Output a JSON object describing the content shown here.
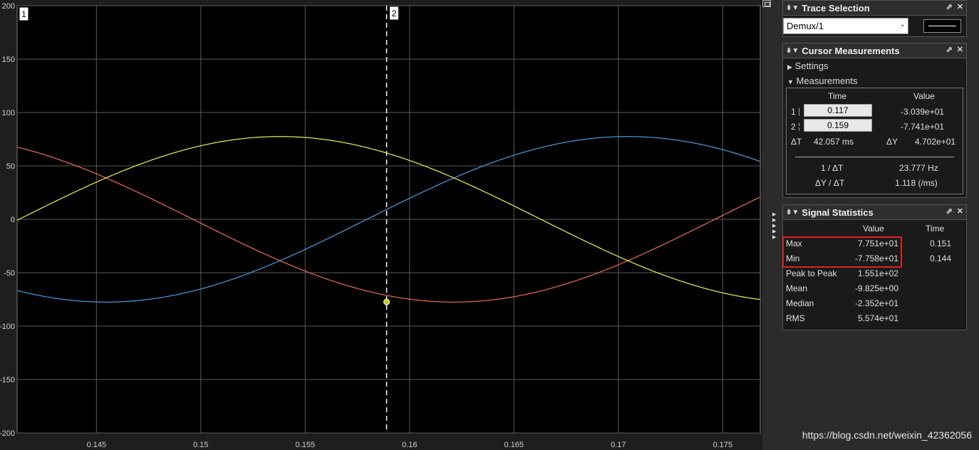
{
  "plot": {
    "y_ticks": [
      "200",
      "150",
      "100",
      "50",
      "0",
      "-50",
      "-100",
      "-150",
      "-200"
    ],
    "x_ticks": [
      "0.145",
      "0.15",
      "0.155",
      "0.16",
      "0.165",
      "0.17",
      "0.175"
    ],
    "cursor1_label": "1",
    "cursor2_label": "2",
    "colors": {
      "background": "#000000",
      "grid": "#5a5a5a",
      "cursor": "#ffffff"
    }
  },
  "chart_data": {
    "type": "line",
    "x_range": [
      0.1412,
      0.1768
    ],
    "ylim": [
      -200,
      200
    ],
    "grid": true,
    "frequency_hz": 20,
    "amplitude": 77.5,
    "series": [
      {
        "color": "#4a9ce0",
        "phase_rad": -1.0
      },
      {
        "color": "#e8704f",
        "phase_rad": -3.0944
      },
      {
        "color": "#f0f058",
        "phase_rad": 1.0944
      }
    ],
    "cursor_marker": {
      "x": 0.1589,
      "y": -77.4
    }
  },
  "trace_selection": {
    "title": "Trace Selection",
    "selected": "Demux/1"
  },
  "cursor_measurements": {
    "title": "Cursor Measurements",
    "settings_label": "Settings",
    "measurements_label": "Measurements",
    "col_time": "Time",
    "col_value": "Value",
    "row1_idx": "1",
    "row1_time": "0.117",
    "row1_value": "-3.039e+01",
    "row2_idx": "2",
    "row2_time": "0.159",
    "row2_value": "-7.741e+01",
    "dt_label": "ΔT",
    "dt_value": "42.057 ms",
    "dy_label": "ΔY",
    "dy_value": "4.702e+01",
    "inv_dt_label": "1 / ΔT",
    "inv_dt_value": "23.777 Hz",
    "dydt_label": "ΔY / ΔT",
    "dydt_value": "1.118 (/ms)"
  },
  "signal_statistics": {
    "title": "Signal Statistics",
    "col_value": "Value",
    "col_time": "Time",
    "rows": [
      {
        "label": "Max",
        "value": "7.751e+01",
        "time": "0.151"
      },
      {
        "label": "Min",
        "value": "-7.758e+01",
        "time": "0.144"
      },
      {
        "label": "Peak to Peak",
        "value": "1.551e+02",
        "time": ""
      },
      {
        "label": "Mean",
        "value": "-9.825e+00",
        "time": ""
      },
      {
        "label": "Median",
        "value": "-2.352e+01",
        "time": ""
      },
      {
        "label": "RMS",
        "value": "5.574e+01",
        "time": ""
      }
    ]
  },
  "watermark": "https://blog.csdn.net/weixin_42362056"
}
